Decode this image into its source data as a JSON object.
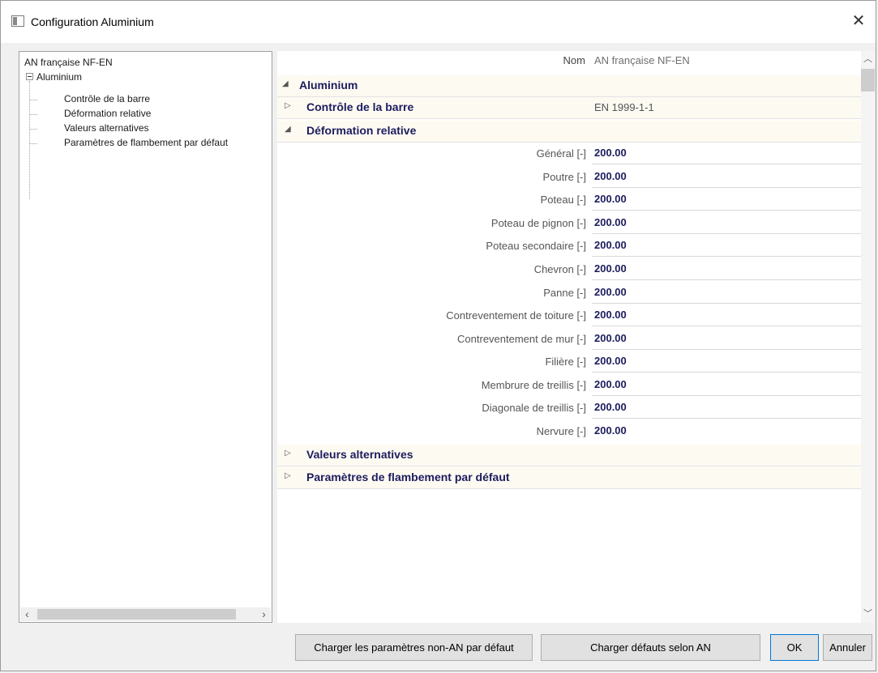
{
  "window": {
    "title": "Configuration Aluminium"
  },
  "tree": {
    "root": "AN française NF-EN",
    "node": "Aluminium",
    "children": [
      "Contrôle de la barre",
      "Déformation relative",
      "Valeurs alternatives",
      "Paramètres de flambement par défaut"
    ]
  },
  "grid": {
    "name_label": "Nom",
    "name_value": "AN française NF-EN",
    "category_aluminium": "Aluminium",
    "category_controle": "Contrôle de la barre",
    "controle_value": "EN 1999-1-1",
    "category_deformation": "Déformation relative",
    "properties": [
      {
        "label": "Général [-]",
        "value": "200.00"
      },
      {
        "label": "Poutre [-]",
        "value": "200.00"
      },
      {
        "label": "Poteau [-]",
        "value": "200.00"
      },
      {
        "label": "Poteau de pignon [-]",
        "value": "200.00"
      },
      {
        "label": "Poteau secondaire [-]",
        "value": "200.00"
      },
      {
        "label": "Chevron [-]",
        "value": "200.00"
      },
      {
        "label": "Panne [-]",
        "value": "200.00"
      },
      {
        "label": "Contreventement de toiture [-]",
        "value": "200.00"
      },
      {
        "label": "Contreventement de mur [-]",
        "value": "200.00"
      },
      {
        "label": "Filière [-]",
        "value": "200.00"
      },
      {
        "label": "Membrure de treillis [-]",
        "value": "200.00"
      },
      {
        "label": "Diagonale de treillis [-]",
        "value": "200.00"
      },
      {
        "label": "Nervure [-]",
        "value": "200.00"
      }
    ],
    "category_valeurs": "Valeurs alternatives",
    "category_flambement": "Paramètres de flambement par défaut"
  },
  "buttons": {
    "load_non_an": "Charger les paramètres non-AN par défaut",
    "load_an": "Charger défauts selon AN",
    "ok": "OK",
    "cancel": "Annuler"
  },
  "icons": {
    "close": "close-icon",
    "app": "window-app-icon",
    "expanded": "triangle-down-icon",
    "collapsed": "triangle-right-icon"
  },
  "colors": {
    "accent_text": "#1c1c5e",
    "category_bg": "#fdfaf2",
    "default_button_border": "#0078d7"
  }
}
